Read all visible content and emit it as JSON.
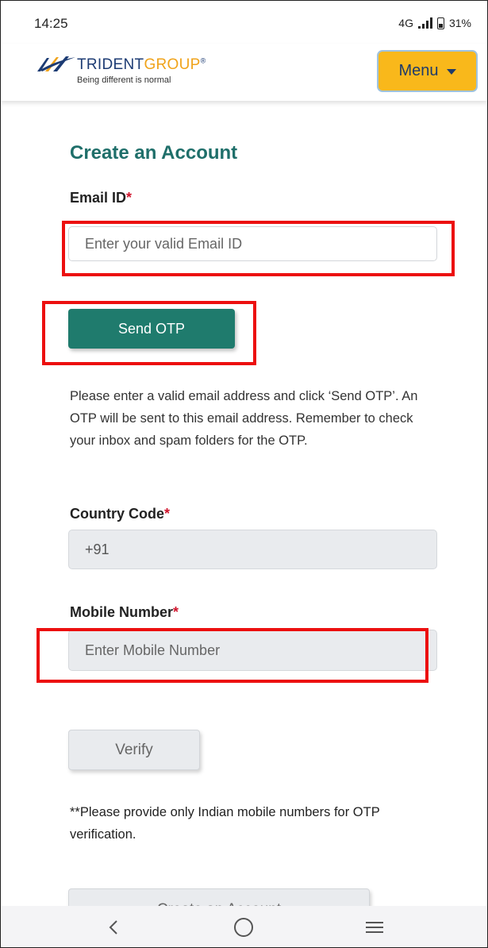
{
  "status_bar": {
    "time": "14:25",
    "network": "4G",
    "battery": "31%"
  },
  "header": {
    "logo": {
      "name_part1": "TRIDENT",
      "name_part2": "GROUP",
      "registered": "®",
      "tagline": "Being different is normal"
    },
    "menu_label": "Menu",
    "colors": {
      "menu_bg": "#f9b81b",
      "brand_blue": "#1c3b73",
      "brand_gold": "#f0a31a"
    }
  },
  "form": {
    "title": "Create an Account",
    "email": {
      "label": "Email ID",
      "required_mark": "*",
      "placeholder": "Enter your valid Email ID",
      "value": ""
    },
    "send_otp_label": "Send OTP",
    "help_text": "Please enter a valid email address and click ‘Send OTP’. An OTP will be sent to this email address. Remember to check your inbox and spam folders for the OTP.",
    "country_code": {
      "label": "Country Code",
      "required_mark": "*",
      "value": "+91"
    },
    "mobile": {
      "label": "Mobile Number",
      "required_mark": "*",
      "placeholder": "Enter Mobile Number",
      "value": ""
    },
    "verify_label": "Verify",
    "note": "**Please provide only Indian mobile numbers for OTP verification.",
    "create_account_label": "Create an Account",
    "colors": {
      "title": "#1f6f6a",
      "primary_button": "#1f7b6d",
      "highlight": "#ec0f0f"
    }
  },
  "nav_bar": {
    "icons": [
      "back-icon",
      "home-icon",
      "recent-apps-icon"
    ]
  }
}
